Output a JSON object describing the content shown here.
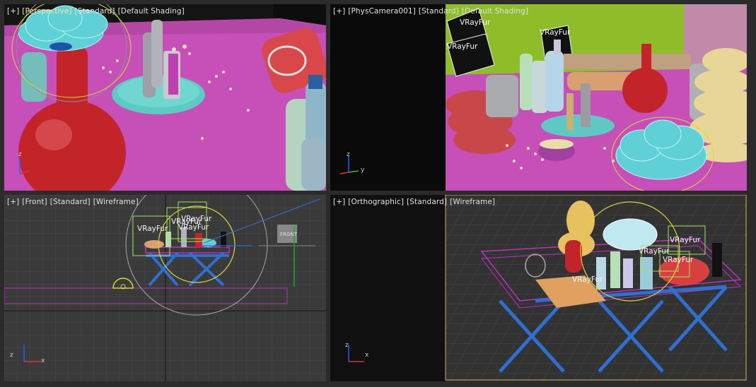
{
  "viewports": {
    "perspective": {
      "label": [
        "[+]",
        "[Perspective]",
        "[Standard]",
        "[Default Shading]"
      ]
    },
    "camera": {
      "label": [
        "[+]",
        "[PhysCamera001]",
        "[Standard]",
        "[Default Shading]"
      ],
      "fur_labels": [
        "VRayFur",
        "VRayFur",
        "VRayFur"
      ]
    },
    "front": {
      "label": [
        "[+]",
        "[Front]",
        "[Standard]",
        "[Wireframe]"
      ],
      "fur_labels": [
        "VRayFur",
        "VRayFur",
        "VRayFur",
        "VRayFur"
      ],
      "object_tag": "FRONT"
    },
    "orthographic": {
      "label": [
        "[+]",
        "[Orthographic]",
        "[Standard]",
        "[Wireframe]"
      ],
      "fur_labels": [
        "VRayFur",
        "VRayFur",
        "VRayFur",
        "VRayFur"
      ]
    }
  },
  "axis_labels": {
    "x": "x",
    "y": "y",
    "z": "z"
  },
  "colors": {
    "table_magenta": "#c850b8",
    "vase_red": "#c0262a",
    "flower_cyan": "#5fd0d6",
    "wire_blue": "#2f6fd0",
    "wire_magenta": "#c030c0",
    "grid": "#4a4a4a",
    "active_border": "#c9b458"
  }
}
